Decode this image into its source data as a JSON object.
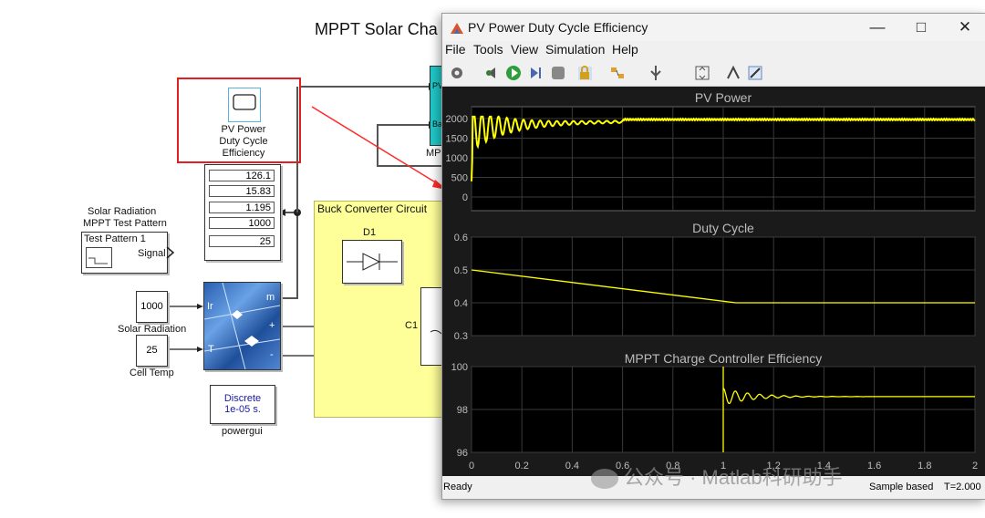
{
  "model": {
    "title": "MPPT Solar Cha",
    "scope_block": {
      "label_line1": "PV Power",
      "label_line2": "Duty Cycle",
      "label_line3": "Efficiency"
    },
    "display_values": [
      "126.1",
      "15.83",
      "1.195",
      "1000",
      "25"
    ],
    "signal_block": {
      "title1": "Solar Radiation",
      "title2": "MPPT Test Pattern",
      "inner_title": "Test Pattern 1",
      "port": "Signal"
    },
    "constant_radiation": {
      "value": "1000",
      "label": "Solar Radiation"
    },
    "constant_temp": {
      "value": "25",
      "label": "Cell Temp"
    },
    "pv_ports": {
      "ir": "Ir",
      "t": "T",
      "m": "m",
      "plus": "+",
      "minus": "-"
    },
    "powergui": {
      "line1": "Discrete",
      "line2": "1e-05 s.",
      "label": "powergui"
    },
    "buck": {
      "title": "Buck Converter Circuit",
      "diode": "D1",
      "cap": "C1"
    },
    "mppt_block": {
      "label": "MP",
      "port1": "PV",
      "port2": "Ba"
    }
  },
  "scope_window": {
    "title": "PV Power Duty Cycle Efficiency",
    "menu": [
      "File",
      "Tools",
      "View",
      "Simulation",
      "Help"
    ],
    "plots": [
      {
        "title": "PV Power",
        "yticks": [
          "2000",
          "1500",
          "1000",
          "500",
          "0"
        ]
      },
      {
        "title": "Duty Cycle",
        "yticks": [
          "0.6",
          "0.5",
          "0.4",
          "0.3"
        ]
      },
      {
        "title": "MPPT Charge Controller Efficiency",
        "yticks": [
          "100",
          "98",
          "96"
        ]
      }
    ],
    "xticks": [
      "0",
      "0.2",
      "0.4",
      "0.6",
      "0.8",
      "1",
      "1.2",
      "1.4",
      "1.6",
      "1.8",
      "2"
    ],
    "status_left": "Ready",
    "status_mid": "Sample based",
    "status_right": "T=2.000",
    "trace_color": "#ffff00"
  },
  "watermark": "公众号 · Matlab科研助手"
}
